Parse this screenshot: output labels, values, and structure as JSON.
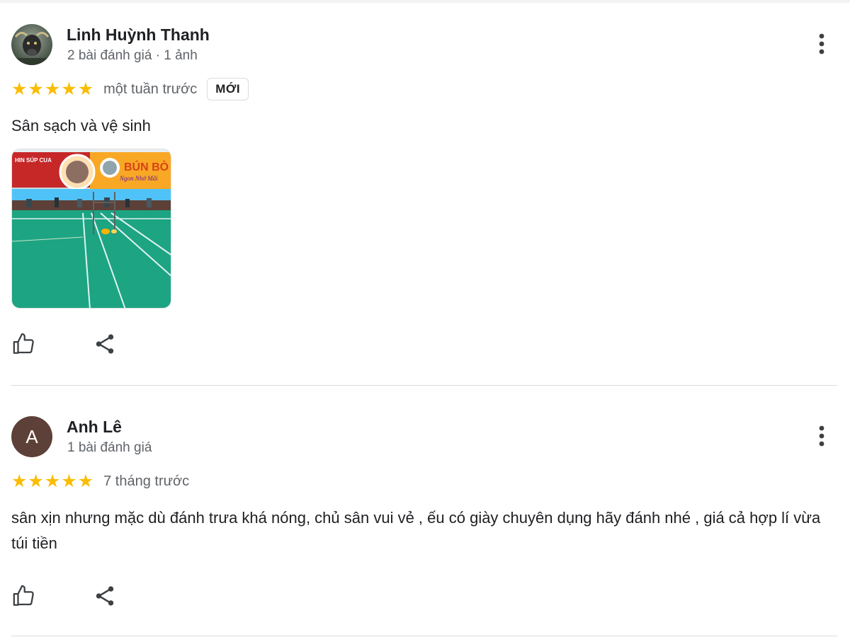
{
  "reviews": [
    {
      "name": "Linh Huỳnh Thanh",
      "meta": "2 bài đánh giá · 1 ảnh",
      "rating": 5,
      "time": "một tuần trước",
      "badge": "MỚI",
      "text": "Sân sạch và vệ sinh",
      "photo_banner_left": "HIN SÚP CUA",
      "photo_banner_right": "BÚN BÒ",
      "photo_banner_script": "Ngon Nhớ Mãi"
    },
    {
      "name": "Anh Lê",
      "avatar_letter": "A",
      "meta": "1 bài đánh giá",
      "rating": 5,
      "time": "7 tháng trước",
      "text": "sân xịn nhưng mặc dù đánh trưa khá nóng, chủ sân vui vẻ , ếu có giày chuyên dụng hãy đánh nhé , giá cả hợp lí vừa túi tiền"
    }
  ],
  "icons": {
    "more": "more-vert-icon",
    "like": "thumb-up-icon",
    "share": "share-icon",
    "star": "star-icon"
  },
  "colors": {
    "star": "#fbbc04",
    "avatar_bg": "#5d4037",
    "secondary_text": "#5f6368",
    "divider": "#dadce0"
  }
}
